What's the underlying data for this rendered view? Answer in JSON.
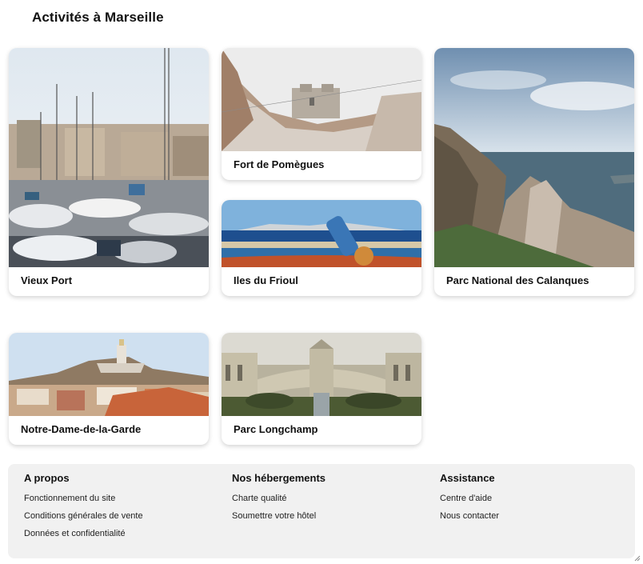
{
  "page": {
    "title": "Activités à Marseille"
  },
  "activities": [
    {
      "name": "Vieux Port"
    },
    {
      "name": "Fort de Pomègues"
    },
    {
      "name": "Iles du Frioul"
    },
    {
      "name": "Parc National des Calanques"
    },
    {
      "name": "Notre-Dame-de-la-Garde"
    },
    {
      "name": "Parc Longchamp"
    }
  ],
  "footer": {
    "columns": [
      {
        "title": "A propos",
        "links": [
          "Fonctionnement du site",
          "Conditions générales de vente",
          "Données et confidentialité"
        ]
      },
      {
        "title": "Nos hébergements",
        "links": [
          "Charte qualité",
          "Soumettre votre hôtel"
        ]
      },
      {
        "title": "Assistance",
        "links": [
          "Centre d'aide",
          "Nous contacter"
        ]
      }
    ]
  }
}
